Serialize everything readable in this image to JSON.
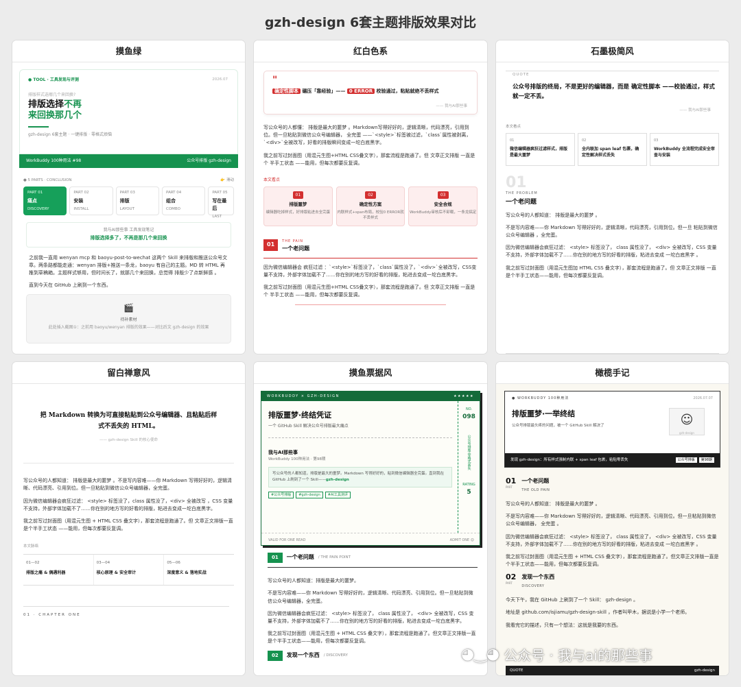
{
  "page_title": "gzh-design 6套主题排版效果对比",
  "watermark": {
    "icon": "wechat-icon",
    "text": "公众号 · 我与ai的那些事"
  },
  "cards": [
    {
      "name": "摸鱼绿",
      "hero_tag": "● TOOL · 工具发现与评测",
      "date": "2026.07",
      "hero_sub": "排版样式选哪几个来回换?",
      "hero_line1": "排版选择",
      "hero_line1_green": "不再",
      "hero_line2": "来回换那几个",
      "hero_desc": "gzh-design 6套主题 · 一键排版 · 零格式烦恼",
      "bar_left": "WorkBuddy 100种用法 #98",
      "bar_right": "公众号排版 gzh-design",
      "parts_label": "● 5 PARTS · CONCLUSION",
      "parts_right": "👉 滑动",
      "parts": [
        {
          "p": "PART 01",
          "t": "痛点",
          "e": "DISCOVERY"
        },
        {
          "p": "PART 02",
          "t": "安装",
          "e": "INSTALL"
        },
        {
          "p": "PART 03",
          "t": "排版",
          "e": "LAYOUT"
        },
        {
          "p": "PART 04",
          "t": "组合",
          "e": "COMBO"
        },
        {
          "p": "PART 05",
          "t": "写在最后",
          "e": "LAST"
        }
      ],
      "quote_top": "我与AI那些事 工具发现笔记",
      "quote_main": "排版选择多了，不再是那几个来回换",
      "p1": "之前我一直用 wenyan mcp 和 baoyu-post-to-wechat 这两个 Skill 来排版和推送公众号文章。两条路都能走通：wenyan 排版+推送一条龙，baoyu 有自己的主题。MD 转 HTML 再推到草稿箱。主题样式够用，但时间长了，就那几个来回换，总觉得 排版少了点新鲜感 。",
      "p2": "直到今天在 GitHub 上刷到一个东西。",
      "ph_icon": "🎬",
      "ph_title": "待补素材",
      "ph_desc": "此处插入截图①：之前用 baoyu/wenyan 排版的效果——对比后文 gzh-design 的效果"
    },
    {
      "name": "红白色系",
      "quote_pre": "确定性脚本",
      "quote_mid": "碾压「靠经验」——",
      "quote_zero": "0 ERROR",
      "quote_end": "校验通过，粘贴就绝不丢样式",
      "quote_src": "—— 我与AI那些事",
      "p1": "写公众号的人都懂： 排版是最大的噩梦 。Markdown写得好好的，逻辑清晰，代码漂亮，引用到位。但一旦粘贴到微信公众号编辑器， 全完蛋 ——`<style>`标签被过滤，`class`属性被剥离，`<div>`全被改写，好看的排版瞬间变成一坨白底黑字。",
      "p2": "我之前写过封面图（用混元生图+HTML CSS叠文字），那套流程是跑通了。但 文章正文排版 一直是个 半手工状态 ——能用，但每次都要反复调。",
      "label": "本文看点",
      "points": [
        {
          "n": "01",
          "t": "排版噩梦",
          "d": "编辑器吃掉样式，好排版粘进去全完蛋"
        },
        {
          "n": "02",
          "t": "确定性方案",
          "d": "内联样式+span布局，校验0 ERROR就不丢样式"
        },
        {
          "n": "03",
          "t": "安全合规",
          "d": "WorkBuddy审核后不卸载，一条龙搞定"
        }
      ],
      "sec_n": "01",
      "sec_en": "THE PAIN",
      "sec_t": "一个老问题",
      "p3": "因为微信编辑器会 疯狂过滤 ：`<style>`标签没了，`class`属性没了，`<div>`全被改写，CSS变量不支持，外部字体加载不了……你在别的地方写的好看的排版，粘进去变成一坨白底黑字。",
      "p4": "我之前写过封面图（用混元生图+HTML CSS叠文字），那套流程是跑通了。但 文章正文排版 一直是个 半手工状态 ——能用，但每次都要反复调。"
    },
    {
      "name": "石墨极简风",
      "quote_lbl": "QUOTE",
      "quote": "公众号排版的终局，不是更好的编辑器，而是 确定性脚本 ——校验通过，样式就一定不丢。",
      "quote_src": "—— 我与AI那些事",
      "label": "本文看点",
      "cols": [
        {
          "n": "01",
          "t": "微信编辑器疯狂过滤样式，排版是最大噩梦"
        },
        {
          "n": "02",
          "t": "全内联加 span leaf 包裹，确定性解决样式丢失"
        },
        {
          "n": "03",
          "t": "WorkBuddy 全流程完成安全审查与安装"
        }
      ],
      "num": "01",
      "en": "THE PROBLEM",
      "h": "一个老问题",
      "p1": "写公众号的人都知道： 排版是最大的噩梦 。",
      "p2": "不是写内容难——你 Markdown 写得好好的，逻辑清晰，代码漂亮，引用到位。但一旦 粘贴到微信公众号编辑器 ，全完蛋。",
      "p3": "因为微信编辑器会疯狂过滤： <style> 标签没了， class 属性没了， <div> 全被改写，CSS 变量不支持，外部字体加载不了……你在别的地方写的好看的排版，粘进去变成 一坨白底黑字 。",
      "p4": "我之前写过封面图（用混元生图加 HTML CSS 叠文字），那套流程是跑通了。但 文章正文排版 一直是个半手工状态——能用，但每次都要反复调。"
    },
    {
      "name": "留白禅意风",
      "quote": "把 Markdown 转换为可直接粘贴到公众号编辑器、且粘贴后样式不丢失的 HTML。",
      "quote_src": "—— gzh-design Skill 的核心使命",
      "p1": "写公众号的人都知道： 排版是最大的噩梦 。不是写内容难——你 Markdown 写得好好的，逻辑清晰、代码漂亮、引用到位。但一旦粘贴到微信公众号编辑器，全完蛋。",
      "p2": "因为微信编辑器会疯狂过滤： <style> 标签没了，class 属性没了，<div> 全被改写 ，CSS 变量不支持，外部字体加载不了……你在别的地方写的好看的排版，粘进去变成一坨白底黑字。",
      "p3": "我之前写过封面图（用混元生图 + HTML CSS 叠文字），那套流程是跑通了。但 文章正文排版一直是个半手工状态 ——能用，但每次都要反复调。",
      "label": "本文脉络",
      "cols": [
        {
          "n": "01—02",
          "t": "排版之痛 & 偶遇利器"
        },
        {
          "n": "03—04",
          "t": "核心原理 & 安全审计"
        },
        {
          "n": "05—06",
          "t": "深度意义 & 落地实战"
        }
      ],
      "chapter": "01 · CHAPTER ONE"
    },
    {
      "name": "摸鱼票据风",
      "tk_left": "WORKBUDDY × GZH-DESIGN",
      "tk_right": "★★★★★",
      "stub_top": "NO.",
      "stub_num": "098",
      "stub_mid": "公众号排版·零格式丢失",
      "stub_bot": "RATING",
      "stub_score": "5",
      "title": "排版噩梦·终结凭证",
      "sub": "一个 GitHub Skill 解决公众号排版最大痛点",
      "au": "我与AI那些事",
      "au2": "WorkBuddy 100种用法 · 第98期",
      "gb1": "写公众号的人都知道，排版是最大的噩梦。Markdown 写得好好的，粘到微信编辑器全完蛋。直到我在 GitHub 上刷到了一个 Skill——",
      "gb2": "gzh-design",
      "tags": [
        "#公众号排版",
        "#gzh-design",
        "#AI工具测评"
      ],
      "ft_left": "VALID FOR ONE READ",
      "ft_right": "ADMIT ONE 😊",
      "sec_n": "01",
      "sec_t": "一个老问题",
      "sec_en": "/ THE PAIN POINT",
      "p1": "写公众号的人都知道：排版是最大的噩梦。",
      "p2": "不是写内容难——你 Markdown 写得好好的，逻辑清晰、代码漂亮、引用到位。但一旦粘贴到微信公众号编辑器，全完蛋。",
      "p3": "因为微信编辑器会疯狂过滤： <style> 标签没了， class 属性没了， <div> 全被改写，CSS 变量不支持，外部字体加载不了……你在别的地方写的好看的排版，粘进去变成一坨白底黑字。",
      "p4": "我之前写过封面图（用混元生图 + HTML CSS 叠文字），那套流程是跑通了。但文章正文排版一直是个半手工状态——能用，但每次都要反复调。",
      "sec2_n": "02",
      "sec2_t": "发现一个东西",
      "sec2_en": "/ DISCOVERY"
    },
    {
      "name": "橄榄手记",
      "tk_tag": "● WORKBUDDY 100种用法",
      "tk_date": "2026.07.07",
      "title": "排版噩梦·一举终结",
      "sub": "公众号排版最头疼的问题，被一个 GitHub Skill 解决了",
      "face": "☺",
      "face_cap": "gzh-design",
      "dk_left": "发现 gzh-design：所有样式强制内联 + span leaf 包裹，粘贴零丢失",
      "dk_tags": [
        "公众号排版",
        "第98期"
      ],
      "s1_n": "01",
      "s1_part": "PART",
      "s1_t": "一个老问题",
      "s1_en": "THE OLD PAIN",
      "p1": "写公众号的人都知道： 排版是最大的噩梦 。",
      "p2": "不是写内容难——你 Markdown 写得好好的，逻辑清晰、代码漂亮、引用到位。但一旦粘贴到微信公众号编辑器， 全完蛋 。",
      "p3": "因为微信编辑器会疯狂过滤： <style> 标签没了， class 属性没了， <div> 全被改写，CSS 变量不支持，外部字体加载不了……你在别的地方写的好看的排版，粘进去变成 一坨白底黑字 。",
      "p4": "我之前写过封面图（用混元生图 + HTML CSS 叠文字），那套流程是跑通了。但文章正文排版一直是个半手工状态——能用，但每次都要反复调。",
      "s2_n": "02",
      "s2_part": "PART",
      "s2_t": "发现一个东西",
      "s2_en": "DISCOVERY",
      "p5": "今天下午，我在 GitHub 上刷到了一个 Skill： gzh-design 。",
      "p6": "地址是 github.com/isjiamu/gzh-design-skill ，作者叫甲木，据说是小学一个老师。",
      "p7": "我看完它的描述，只有一个想法：这就是我要的东西。",
      "ft_left": "QUOTE",
      "ft_right": "gzh-design"
    }
  ]
}
